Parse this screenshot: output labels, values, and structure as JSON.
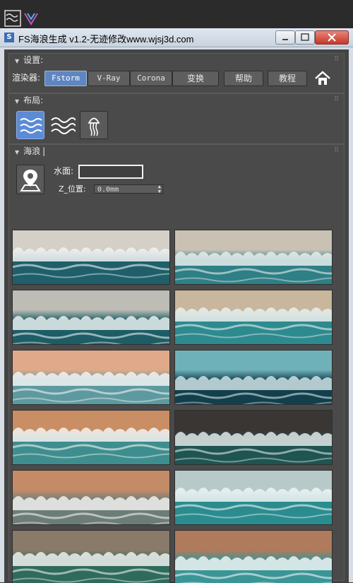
{
  "window": {
    "title": "FS海浪生成 v1.2-无迹修改www.wjsj3d.com",
    "app_icon_text": "S"
  },
  "settings": {
    "header": "设置:",
    "renderer_label": "渲染器:",
    "renderer_buttons": [
      "Fstorm",
      "V-Ray",
      "Corona"
    ],
    "active_renderer": "Fstorm",
    "convert_label": "变换",
    "help_label": "帮助",
    "tutorial_label": "教程"
  },
  "layout": {
    "header": "布局:",
    "icons": [
      "waves-flat-icon",
      "waves-stacked-icon",
      "jellyfish-icon"
    ],
    "active": "waves-flat-icon"
  },
  "waves": {
    "header": "海浪",
    "water_label": "水面:",
    "water_value": "",
    "zpos_label": "Z_位置:",
    "zpos_value": "0.0mm"
  },
  "thumbnails": {
    "count": 12,
    "description_palettes": [
      [
        "#d4d0c8",
        "#1e5f6a",
        "#eef2f2"
      ],
      [
        "#c9c2b4",
        "#2e7f86",
        "#e6ecec"
      ],
      [
        "#bdbdb5",
        "#1c5d66",
        "#e9eeee"
      ],
      [
        "#c8b79d",
        "#2d8a8f",
        "#eaf0ef"
      ],
      [
        "#e0a98a",
        "#5d9aa0",
        "#f1f3f2"
      ],
      [
        "#6fb1b9",
        "#123f4c",
        "#cfe3e5"
      ],
      [
        "#c98e63",
        "#3e8e8f",
        "#f3f3f1"
      ],
      [
        "#3a3633",
        "#1e5452",
        "#e3e7e6"
      ],
      [
        "#c48b67",
        "#6c7d78",
        "#f1f0ee"
      ],
      [
        "#b7c9c8",
        "#2a8c8f",
        "#eef4f4"
      ],
      [
        "#8a7a6a",
        "#2f6b5c",
        "#eef0ee"
      ],
      [
        "#b07a5c",
        "#3a9596",
        "#f0f3f3"
      ]
    ]
  }
}
